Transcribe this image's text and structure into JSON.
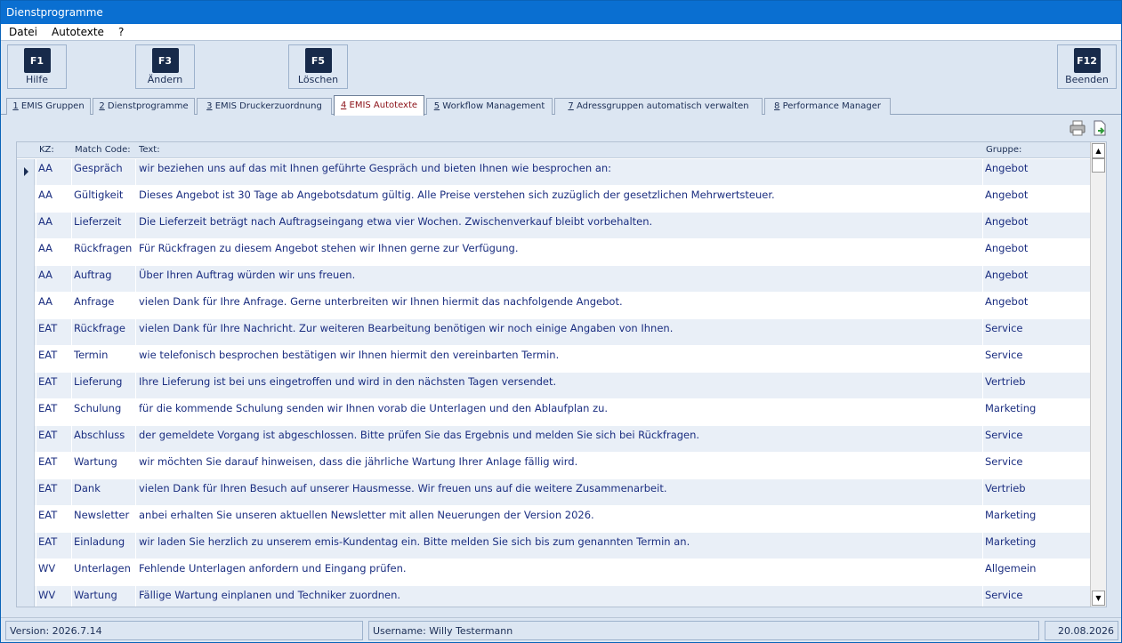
{
  "window": {
    "title": "Dienstprogramme"
  },
  "menu": [
    "Datei",
    "Autotexte",
    "?"
  ],
  "toolbar": {
    "buttons": [
      {
        "key": "F1",
        "label": "Hilfe"
      },
      {
        "key": "F3",
        "label": "Ändern"
      },
      {
        "key": "F5",
        "label": "Löschen"
      },
      {
        "key": "F12",
        "label": "Beenden"
      }
    ]
  },
  "tabs": [
    {
      "num": "1",
      "label": " EMIS Gruppen"
    },
    {
      "num": "2",
      "label": " Dienstprogramme"
    },
    {
      "num": "3",
      "label": " EMIS Druckerzuordnung"
    },
    {
      "num": "4",
      "label": " EMIS Autotexte",
      "active": true
    },
    {
      "num": "5",
      "label": " Workflow Management"
    },
    {
      "num": "7",
      "label": " Adressgruppen automatisch verwalten"
    },
    {
      "num": "8",
      "label": " Performance Manager"
    }
  ],
  "icons": {
    "print": "printer-icon",
    "export": "export-icon"
  },
  "grid": {
    "columns": {
      "kz": "KZ:",
      "match": "Match Code:",
      "text": "Text:",
      "group": "Gruppe:"
    },
    "rows": [
      {
        "kz": "AA",
        "match": "Gespräch",
        "text": "wir beziehen uns auf das mit Ihnen geführte Gespräch und bieten Ihnen wie besprochen an:",
        "group": "Angebot"
      },
      {
        "kz": "AA",
        "match": "Gültigkeit",
        "text": "Dieses Angebot ist 30 Tage ab Angebotsdatum gültig. Alle Preise verstehen sich zuzüglich der gesetzlichen Mehrwertsteuer.",
        "group": "Angebot"
      },
      {
        "kz": "AA",
        "match": "Lieferzeit",
        "text": "Die Lieferzeit beträgt nach Auftragseingang etwa vier Wochen. Zwischenverkauf bleibt vorbehalten.",
        "group": "Angebot"
      },
      {
        "kz": "AA",
        "match": "Rückfragen",
        "text": "Für Rückfragen zu diesem Angebot stehen wir Ihnen gerne zur Verfügung.",
        "group": "Angebot"
      },
      {
        "kz": "AA",
        "match": "Auftrag",
        "text": "Über Ihren Auftrag würden wir uns freuen.",
        "group": "Angebot"
      },
      {
        "kz": "AA",
        "match": "Anfrage",
        "text": "vielen Dank für Ihre Anfrage. Gerne unterbreiten wir Ihnen hiermit das nachfolgende Angebot.",
        "group": "Angebot"
      },
      {
        "kz": "EAT",
        "match": "Rückfrage",
        "text": "vielen Dank für Ihre Nachricht. Zur weiteren Bearbeitung benötigen wir noch einige Angaben von Ihnen.",
        "group": "Service"
      },
      {
        "kz": "EAT",
        "match": "Termin",
        "text": "wie telefonisch besprochen bestätigen wir Ihnen hiermit den vereinbarten Termin.",
        "group": "Service"
      },
      {
        "kz": "EAT",
        "match": "Lieferung",
        "text": "Ihre Lieferung ist bei uns eingetroffen und wird in den nächsten Tagen versendet.",
        "group": "Vertrieb"
      },
      {
        "kz": "EAT",
        "match": "Schulung",
        "text": "für die kommende Schulung senden wir Ihnen vorab die Unterlagen und den Ablaufplan zu.",
        "group": "Marketing"
      },
      {
        "kz": "EAT",
        "match": "Abschluss",
        "text": "der gemeldete Vorgang ist abgeschlossen. Bitte prüfen Sie das Ergebnis und melden Sie sich bei Rückfragen.",
        "group": "Service"
      },
      {
        "kz": "EAT",
        "match": "Wartung",
        "text": "wir möchten Sie darauf hinweisen, dass die jährliche Wartung Ihrer Anlage fällig wird.",
        "group": "Service"
      },
      {
        "kz": "EAT",
        "match": "Dank",
        "text": "vielen Dank für Ihren Besuch auf unserer Hausmesse. Wir freuen uns auf die weitere Zusammenarbeit.",
        "group": "Vertrieb"
      },
      {
        "kz": "EAT",
        "match": "Newsletter",
        "text": "anbei erhalten Sie unseren aktuellen Newsletter mit allen Neuerungen der Version 2026.",
        "group": "Marketing"
      },
      {
        "kz": "EAT",
        "match": "Einladung",
        "text": "wir laden Sie herzlich zu unserem emis-Kundentag ein. Bitte melden Sie sich bis zum genannten Termin an.",
        "group": "Marketing"
      },
      {
        "kz": "WV",
        "match": "Unterlagen",
        "text": "Fehlende Unterlagen anfordern und Eingang prüfen.",
        "group": "Allgemein"
      },
      {
        "kz": "WV",
        "match": "Wartung",
        "text": "Fällige Wartung einplanen und Techniker zuordnen.",
        "group": "Service"
      }
    ]
  },
  "status": {
    "version": "Version: 2026.7.14",
    "username": "Username: Willy Testermann",
    "date": "20.08.2026"
  },
  "colors": {
    "titlebar": "#0a6fd1",
    "fkey": "#172a4a",
    "active_tab_text": "#8a0f16"
  }
}
